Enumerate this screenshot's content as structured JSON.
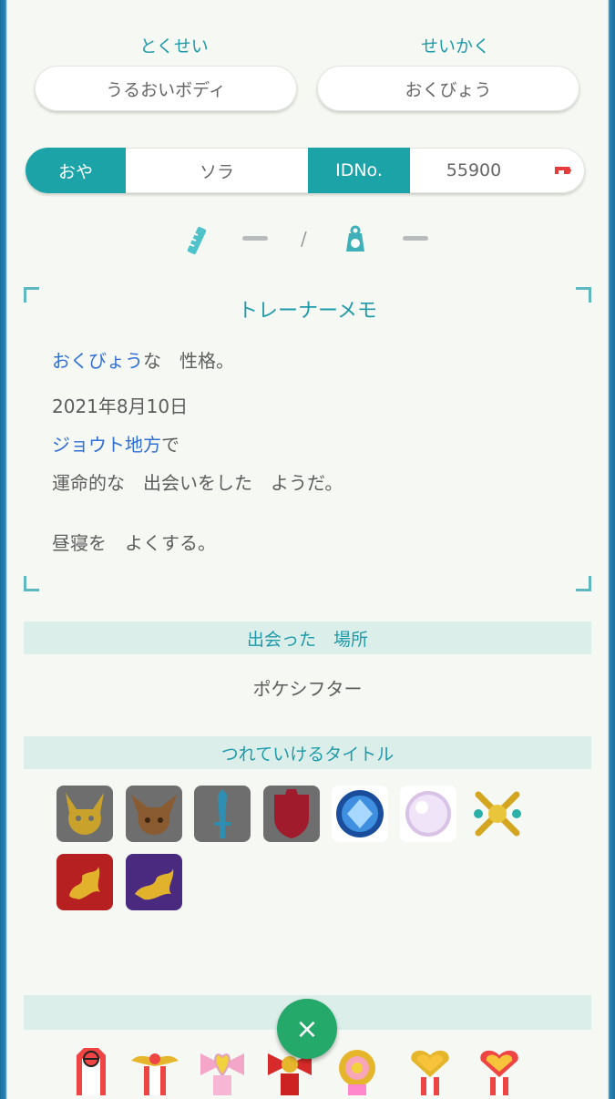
{
  "ability": {
    "title": "とくせい",
    "value": "うるおいボディ"
  },
  "nature": {
    "title": "せいかく",
    "value": "おくびょう"
  },
  "ot": {
    "label": "おや",
    "name": "ソラ",
    "id_label": "IDNo.",
    "id_value": "55900"
  },
  "measurements": {
    "height_value": "—",
    "separator": "/",
    "weight_value": "—"
  },
  "memo": {
    "title": "トレーナーメモ",
    "nature_word": "おくびょう",
    "nature_suffix": "な　性格。",
    "date": "2021年8月10日",
    "region": "ジョウト地方",
    "region_suffix": "で",
    "meeting": "運命的な　出会いをした　ようだ。",
    "characteristic": "昼寝を　よくする。"
  },
  "met_location": {
    "title": "出会った　場所",
    "value": "ポケシフター"
  },
  "titles": {
    "title": "つれていけるタイトル",
    "badges": [
      "pikachu-mark",
      "eevee-mark",
      "sword-mark",
      "shield-mark",
      "diamond-mark",
      "pearl-mark",
      "crossed-arrows-mark",
      "legend-gold-mark",
      "legend-purple-mark"
    ]
  },
  "ribbons": {
    "title": "",
    "medals": [
      "poke-ball-ribbon",
      "wing-ribbon",
      "pink-bow-ribbon",
      "red-bow-ribbon",
      "flower-ribbon",
      "heart-ribbon",
      "heart-ribbon-2"
    ]
  },
  "fab": {
    "label": "×"
  },
  "colors": {
    "accent": "#1ba3a8",
    "title_text": "#1f9aa8",
    "link_blue": "#2f6fd6",
    "section_bg": "#dbeeea",
    "fab_green": "#25a96a"
  }
}
